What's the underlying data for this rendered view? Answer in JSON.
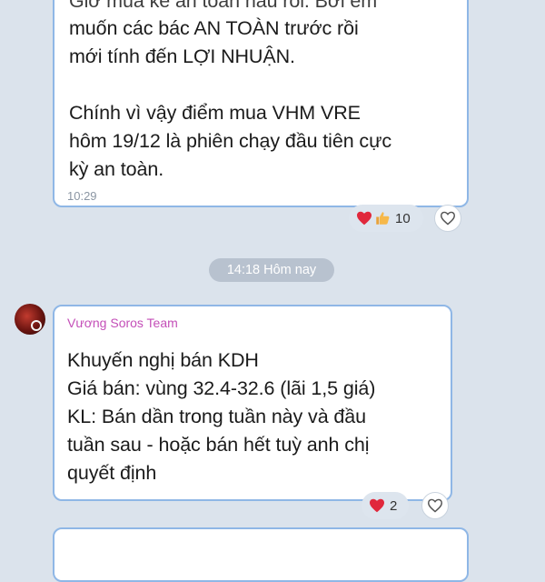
{
  "messages": [
    {
      "text_partial_top": "Giờ mua kể an toàn hầu rồi. Bởi em",
      "text": "muốn các bác AN TOÀN trước rồi\nmới tính đến LỢI NHUẬN.\n\nChính vì vậy điểm mua VHM VRE\nhôm 19/12 là phiên chạy đầu tiên cực\nkỳ an toàn.",
      "time": "10:29",
      "reactions": {
        "emojis": [
          "heart",
          "thumbs-up"
        ],
        "count": "10"
      }
    },
    {
      "sender": "Vương Soros Team",
      "text": "Khuyến nghị bán KDH\nGiá bán: vùng 32.4-32.6 (lãi 1,5 giá)\nKL: Bán dần  trong tuần này và đầu\ntuần sau - hoặc bán hết tuỳ anh chị\nquyết định",
      "reactions": {
        "emojis": [
          "heart"
        ],
        "count": "2"
      }
    }
  ],
  "date_separator": "14:18 Hôm nay",
  "colors": {
    "background": "#dbe3ec",
    "bubble_border": "#8fb7e6",
    "sender_name": "#c44fb8",
    "heart": "#e0283c"
  }
}
